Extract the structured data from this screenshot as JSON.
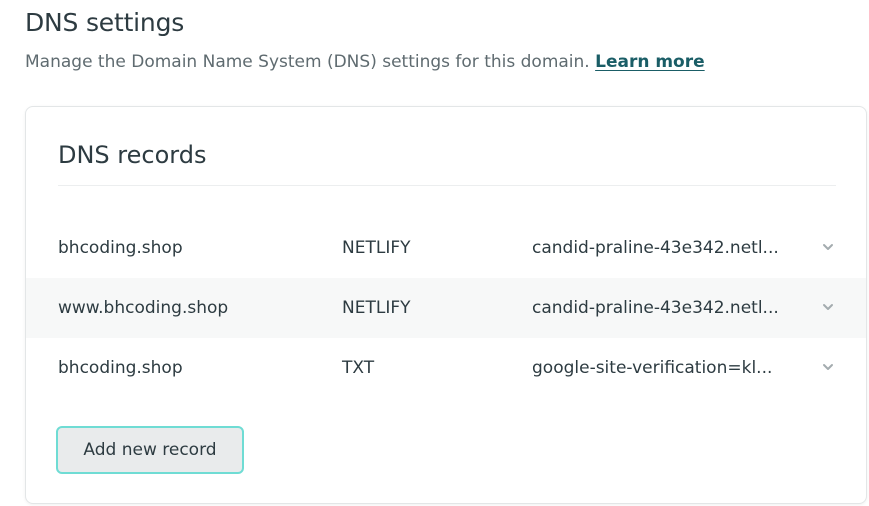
{
  "page": {
    "title": "DNS settings",
    "description": "Manage the Domain Name System (DNS) settings for this domain.",
    "learn_more": "Learn more"
  },
  "card": {
    "title": "DNS records",
    "records": [
      {
        "host": "bhcoding.shop",
        "type": "NETLIFY",
        "value": "candid-praline-43e342.netl..."
      },
      {
        "host": "www.bhcoding.shop",
        "type": "NETLIFY",
        "value": "candid-praline-43e342.netl..."
      },
      {
        "host": "bhcoding.shop",
        "type": "TXT",
        "value": "google-site-verification=kl..."
      }
    ],
    "add_button": "Add new record"
  },
  "colors": {
    "accent": "#6fdcd4",
    "link": "#1a5d66",
    "text": "#2d3b41",
    "row_alt": "#f7f8f8"
  },
  "icons": {
    "expand": "chevron-down-icon"
  }
}
